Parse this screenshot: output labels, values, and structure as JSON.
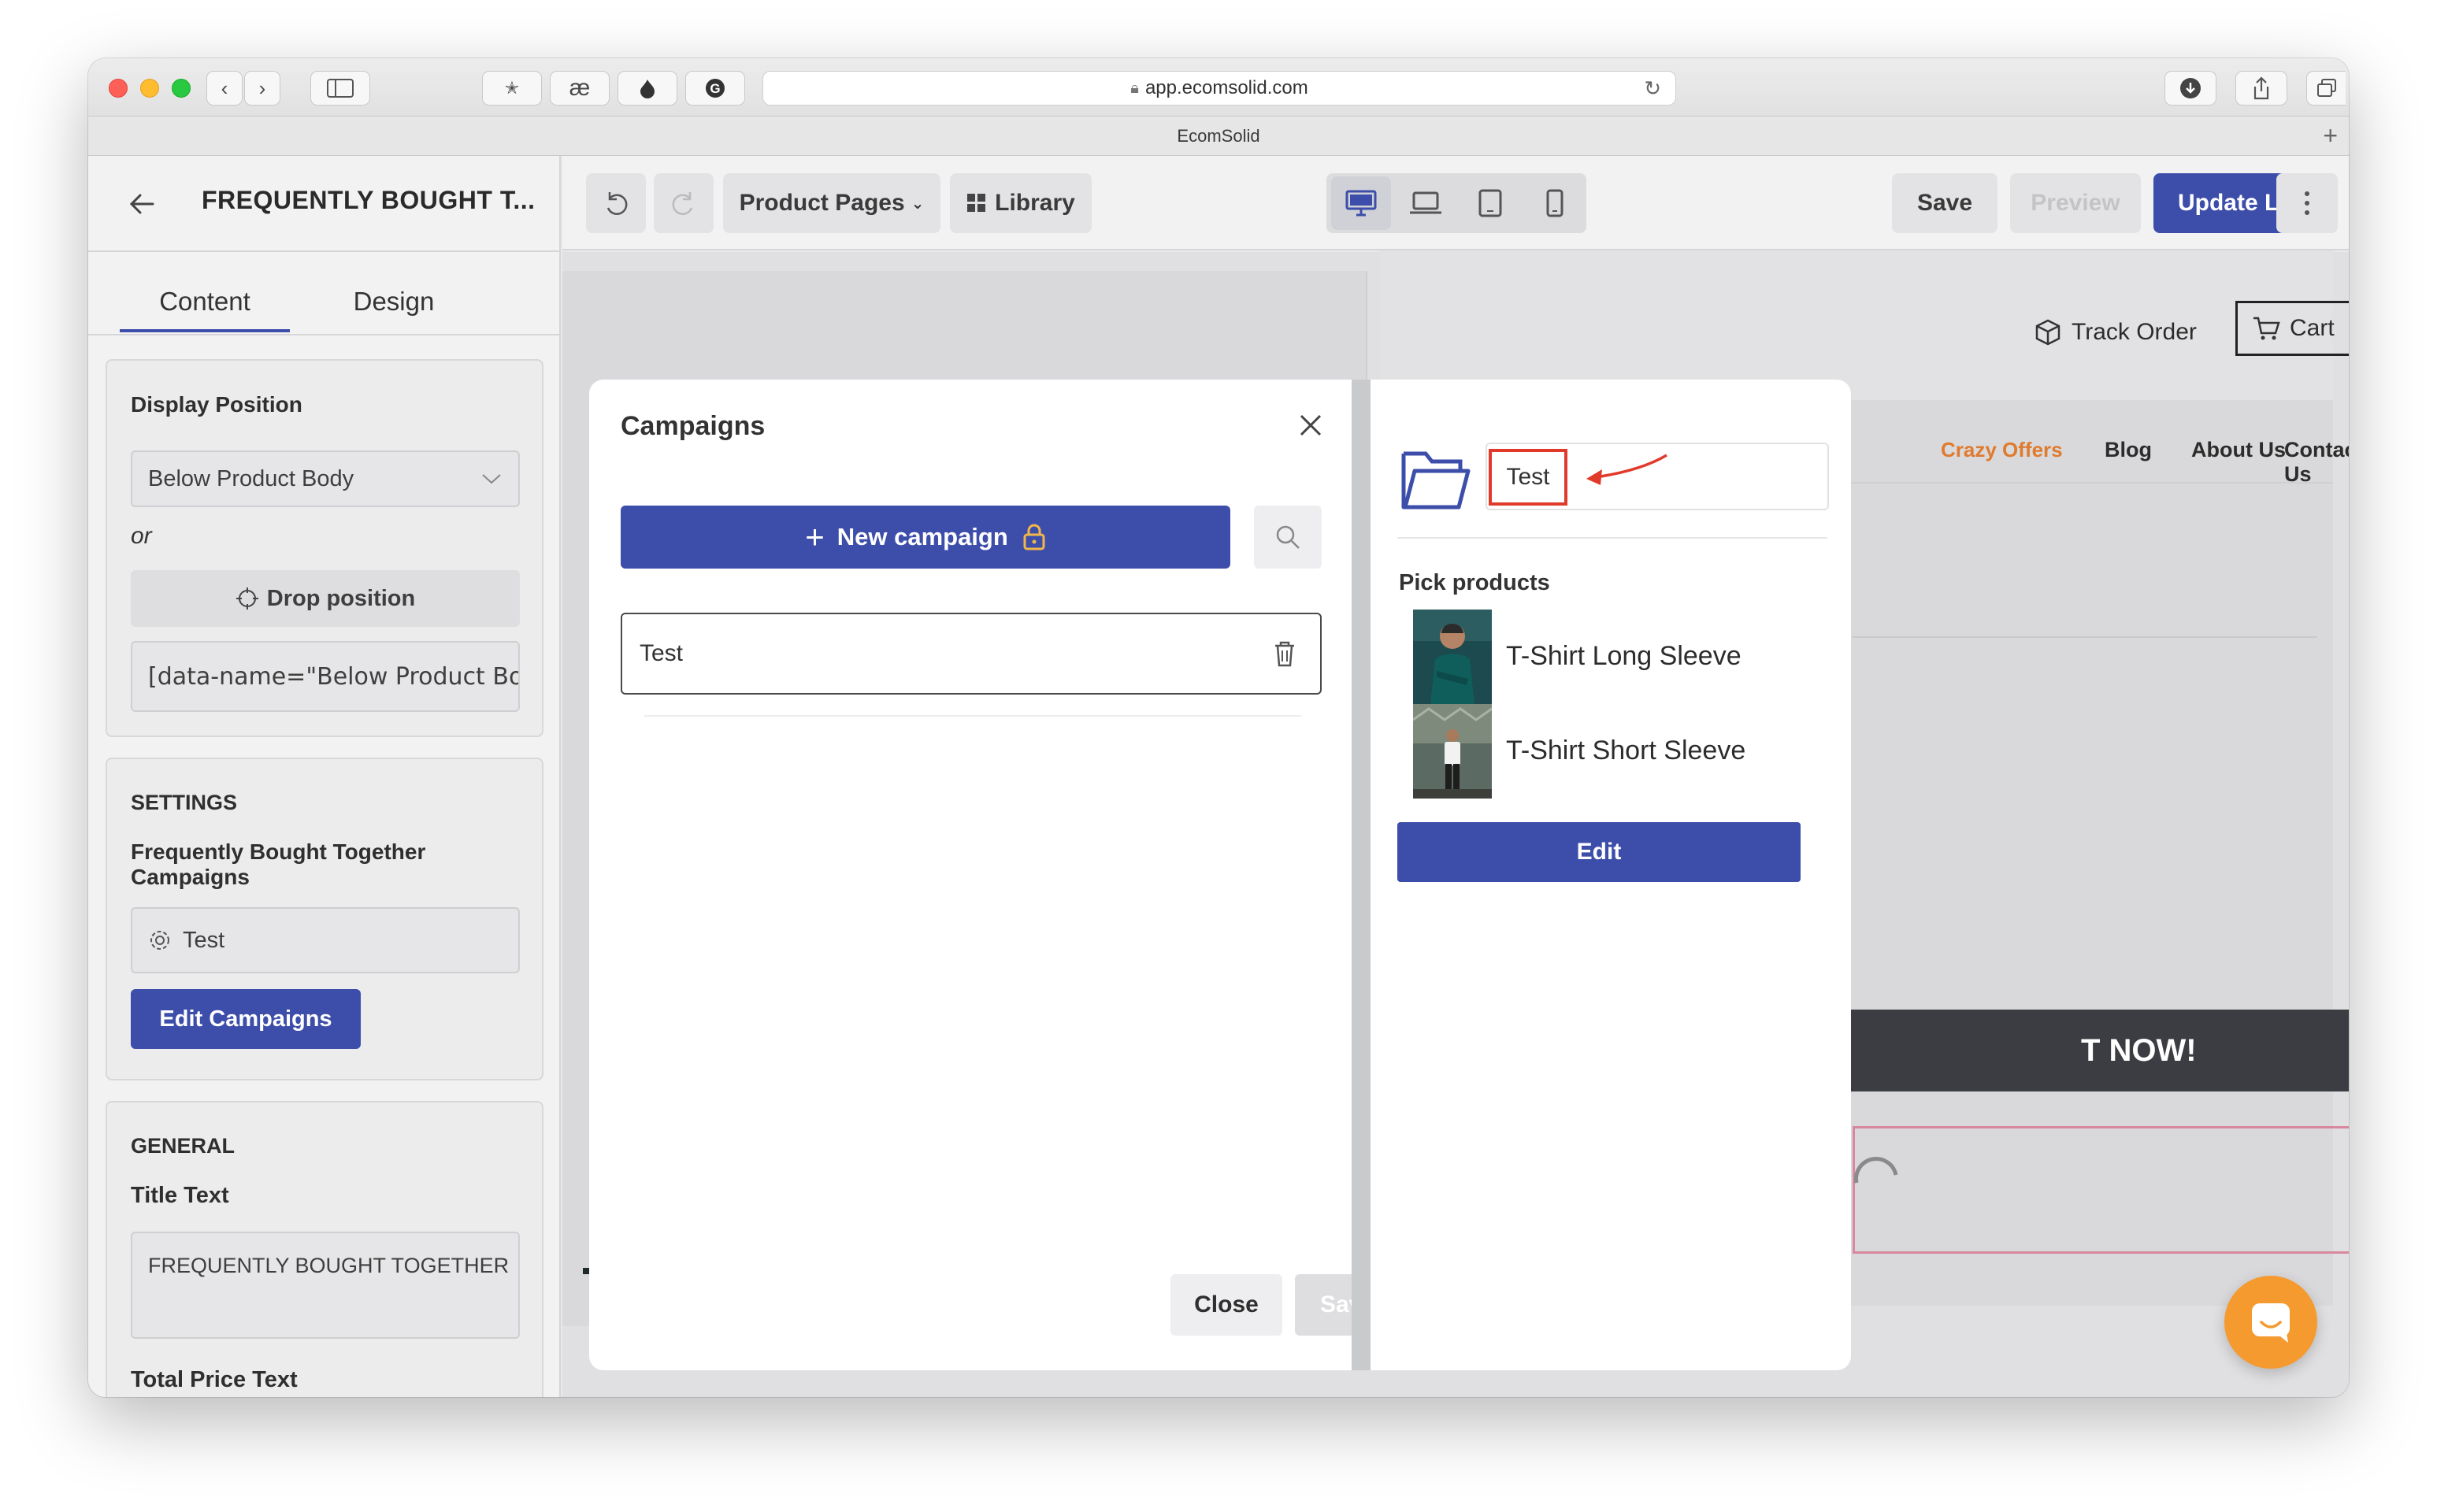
{
  "browser": {
    "url": "app.ecomsolid.com",
    "tab_title": "EcomSolid"
  },
  "sidebar": {
    "title": "FREQUENTLY BOUGHT T...",
    "tabs": [
      {
        "label": "Content"
      },
      {
        "label": "Design"
      }
    ],
    "display_position": {
      "label": "Display Position",
      "value": "Below Product Body",
      "or_text": "or",
      "drop_button": "Drop position",
      "selector_value": "[data-name=\"Below Product Body\"]"
    },
    "settings": {
      "heading": "SETTINGS",
      "campaigns_label": "Frequently Bought Together Campaigns",
      "campaign_value": "Test",
      "edit_button": "Edit Campaigns"
    },
    "general": {
      "heading": "GENERAL",
      "title_text_label": "Title Text",
      "title_text_value": "FREQUENTLY BOUGHT TOGETHER",
      "total_price_label": "Total Price Text"
    }
  },
  "toolbar": {
    "page_selector": "Product Pages",
    "library": "Library",
    "save": "Save",
    "preview": "Preview",
    "update_live": "Update Live"
  },
  "modal": {
    "title": "Campaigns",
    "new_campaign_button": "New campaign",
    "campaigns": [
      {
        "name": "Test"
      }
    ],
    "close_button": "Close",
    "save_button": "Save"
  },
  "campaign_detail": {
    "name_value": "Test",
    "pick_products_label": "Pick products",
    "products": [
      {
        "name": "T-Shirt Long Sleeve"
      },
      {
        "name": "T-Shirt Short Sleeve"
      }
    ],
    "edit_button": "Edit"
  },
  "store": {
    "track_order": "Track Order",
    "cart": "Cart",
    "nav": [
      {
        "label": "Crazy Offers"
      },
      {
        "label": "Blog"
      },
      {
        "label": "About Us"
      },
      {
        "label": "Contact Us"
      }
    ],
    "buy_now_partial": "T NOW!"
  },
  "colors": {
    "brand_blue": "#3d4eaa",
    "accent_orange": "#e07a2e",
    "annotation_red": "#e23a2a",
    "chat_orange": "#f59a2f"
  }
}
